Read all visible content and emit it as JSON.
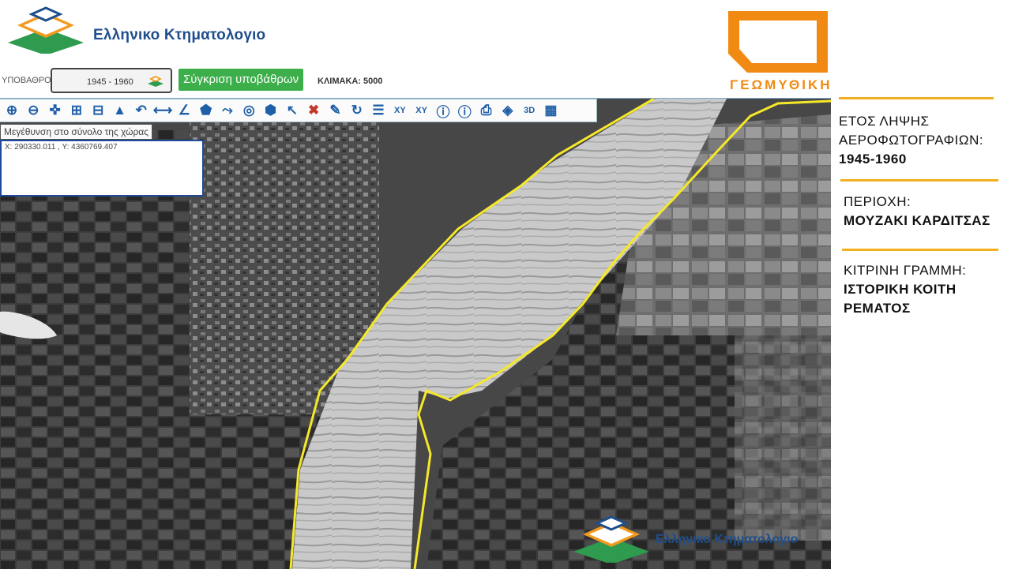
{
  "header": {
    "logo_text": "Ελληνικο Κτηματολογιο",
    "basemap_label": "ΥΠΟΒΑΘΡΟ:",
    "basemap_value": "1945 - 1960",
    "compare_button": "Σύγκριση υποβάθρων",
    "scale_label": "ΚΛΙΜΑΚΑ: 5000",
    "brand_text": "ΓΕΩΜΥΘΙΚΗ"
  },
  "toolbar": {
    "tools": [
      "zoom-in",
      "zoom-out",
      "pan",
      "zoom-box-in",
      "zoom-box-out",
      "full-extent",
      "previous-extent",
      "measure-distance",
      "measure-angle",
      "measure-area",
      "draw-line",
      "draw-circle",
      "select-polygon",
      "select",
      "clear",
      "edit",
      "refresh",
      "legend",
      "xy-locate",
      "xy-go",
      "info",
      "identify",
      "print",
      "layers",
      "3D",
      "export"
    ],
    "xy_label": "XY",
    "three_d_label": "3D",
    "tooltip": "Μεγέθυνση στο σύνολο της χώρας"
  },
  "coord_panel": {
    "text": "X: 290330.011 , Y: 4360769.407"
  },
  "map": {
    "watermark_text": "Ελληνικο Κτηματολογιο",
    "line_color": "#f5e829"
  },
  "info_panel": {
    "year_label_1": "ΕΤΟΣ ΛΗΨΗΣ",
    "year_label_2": "ΑΕΡΟΦΩΤΟΓΡΑΦΙΩΝ:",
    "year_value": "1945-1960",
    "area_label": "ΠΕΡΙΟΧΗ:",
    "area_value": "ΜΟΥΖΑΚΙ ΚΑΡΔΙΤΣΑΣ",
    "line_label": "ΚΙΤΡΙΝΗ ΓΡΑΜΜΗ:",
    "line_value_1": "ΙΣΤΟΡΙΚΗ ΚΟΙΤΗ",
    "line_value_2": "ΡΕΜΑΤΟΣ"
  },
  "colors": {
    "accent_orange": "#f08a13",
    "rule_yellow": "#f2b01e",
    "compare_green": "#3cae4a",
    "brand_blue": "#1f4e8c"
  }
}
